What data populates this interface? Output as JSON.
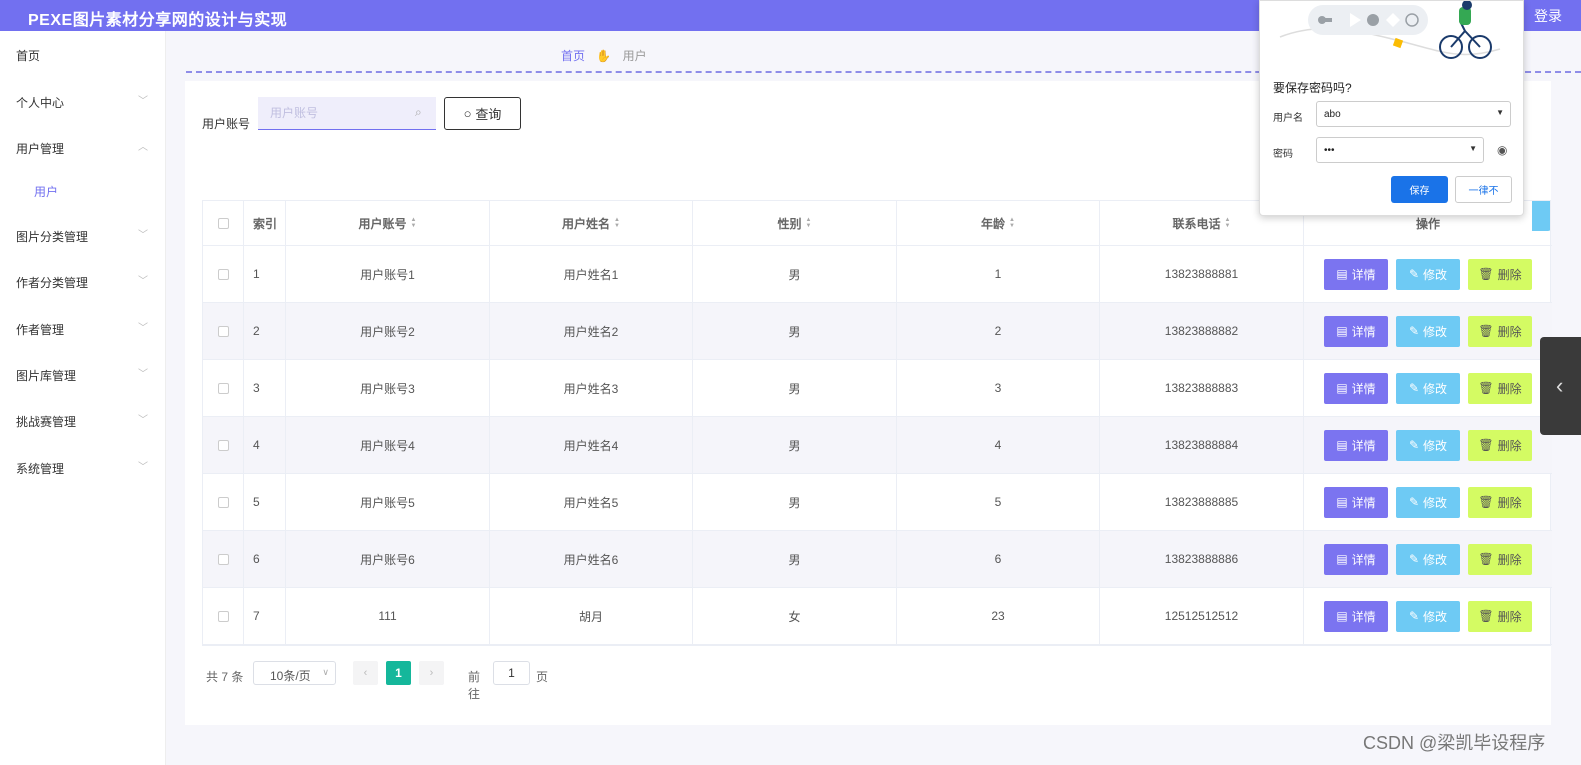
{
  "header": {
    "title": "PEXE图片素材分享网的设计与实现",
    "login": "登录"
  },
  "sidebar": {
    "items": [
      {
        "label": "首页",
        "chevron": ""
      },
      {
        "label": "个人中心",
        "chevron": "﹀"
      },
      {
        "label": "用户管理",
        "chevron": "︿"
      },
      {
        "label": "用户",
        "chevron": ""
      },
      {
        "label": "图片分类管理",
        "chevron": "﹀"
      },
      {
        "label": "作者分类管理",
        "chevron": "﹀"
      },
      {
        "label": "作者管理",
        "chevron": "﹀"
      },
      {
        "label": "图片库管理",
        "chevron": "﹀"
      },
      {
        "label": "挑战赛管理",
        "chevron": "﹀"
      },
      {
        "label": "系统管理",
        "chevron": "﹀"
      }
    ]
  },
  "breadcrumb": {
    "home": "首页",
    "current": "用户"
  },
  "search": {
    "label": "用户账号",
    "placeholder": "用户账号",
    "button": "查询"
  },
  "table": {
    "headers": [
      "索引",
      "用户账号",
      "用户姓名",
      "性别",
      "年龄",
      "联系电话",
      "操作"
    ],
    "rows": [
      {
        "index": "1",
        "account": "用户账号1",
        "name": "用户姓名1",
        "gender": "男",
        "age": "1",
        "phone": "13823888881"
      },
      {
        "index": "2",
        "account": "用户账号2",
        "name": "用户姓名2",
        "gender": "男",
        "age": "2",
        "phone": "13823888882"
      },
      {
        "index": "3",
        "account": "用户账号3",
        "name": "用户姓名3",
        "gender": "男",
        "age": "3",
        "phone": "13823888883"
      },
      {
        "index": "4",
        "account": "用户账号4",
        "name": "用户姓名4",
        "gender": "男",
        "age": "4",
        "phone": "13823888884"
      },
      {
        "index": "5",
        "account": "用户账号5",
        "name": "用户姓名5",
        "gender": "男",
        "age": "5",
        "phone": "13823888885"
      },
      {
        "index": "6",
        "account": "用户账号6",
        "name": "用户姓名6",
        "gender": "男",
        "age": "6",
        "phone": "13823888886"
      },
      {
        "index": "7",
        "account": "111",
        "name": "胡月",
        "gender": "女",
        "age": "23",
        "phone": "12512512512"
      }
    ],
    "actions": {
      "detail": "详情",
      "edit": "修改",
      "delete": "删除"
    }
  },
  "pagination": {
    "total": "共 7 条",
    "page_size": "10条/页",
    "current_page": "1",
    "goto_label": "前往",
    "goto_value": "1",
    "page_suffix": "页"
  },
  "password_popup": {
    "title": "要保存密码吗?",
    "username_label": "用户名",
    "username_value": "abo",
    "password_label": "密码",
    "password_value": "•••",
    "save": "保存",
    "never": "一律不"
  },
  "watermark": "CSDN @梁凯毕设程序",
  "colors": {
    "header": "#7270f0",
    "detail": "#7b74f0",
    "edit": "#6ecaf4",
    "delete": "#d4fb63",
    "page_active": "#15b79b"
  }
}
